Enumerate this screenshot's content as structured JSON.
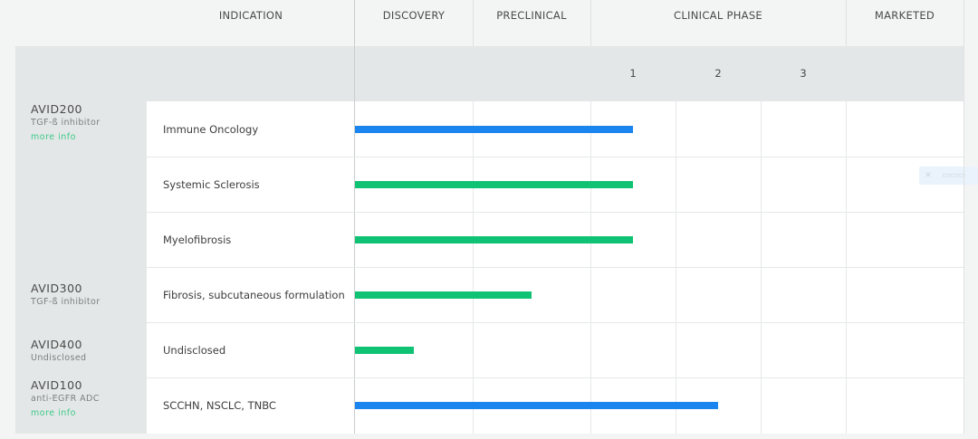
{
  "header": {
    "indication": "INDICATION",
    "discovery": "DISCOVERY",
    "preclinical": "PRECLINICAL",
    "clinical_phase": "CLINICAL PHASE",
    "marketed": "MARKETED"
  },
  "phases": [
    "1",
    "2",
    "3"
  ],
  "programs": [
    {
      "name": "AVID200",
      "subtitle": "TGF-ß inhibitor",
      "link": "more info"
    },
    {
      "name": "AVID300",
      "subtitle": "TGF-ß inhibitor"
    },
    {
      "name": "AVID400",
      "subtitle": "Undisclosed"
    },
    {
      "name": "AVID100",
      "subtitle": "anti-EGFR ADC",
      "link": "more info"
    }
  ],
  "rows": [
    {
      "indication": "Immune Oncology",
      "progress_stage": 3.0,
      "color": "#1a85ee"
    },
    {
      "indication": "Systemic Sclerosis",
      "progress_stage": 3.0,
      "color": "#10c274"
    },
    {
      "indication": "Myelofibrosis",
      "progress_stage": 3.0,
      "color": "#10c274"
    },
    {
      "indication": "Fibrosis, subcutaneous formulation",
      "progress_stage": 1.5,
      "color": "#10c274"
    },
    {
      "indication": "Undisclosed",
      "progress_stage": 0.5,
      "color": "#10c274"
    },
    {
      "indication": "SCCHN, NSCLC, TNBC",
      "progress_stage": 4.0,
      "color": "#1a85ee"
    }
  ],
  "colors": {
    "clinical_bar": "#1a85ee",
    "preclinical_bar": "#10c274",
    "link": "#3cc98a"
  }
}
